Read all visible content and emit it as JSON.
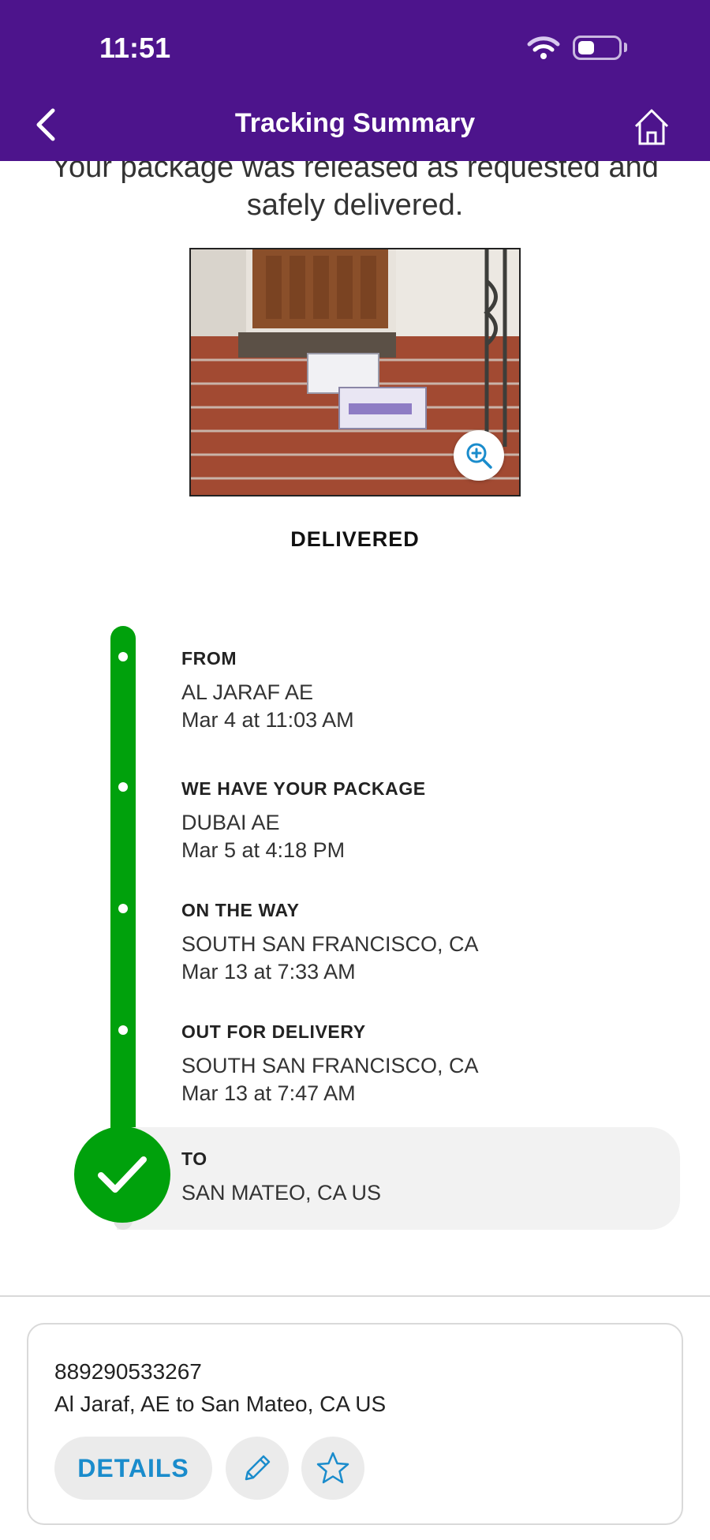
{
  "status_bar": {
    "time": "11:51"
  },
  "header": {
    "title": "Tracking Summary"
  },
  "message": "Your package was released as requested and safely delivered.",
  "status": "DELIVERED",
  "timeline": [
    {
      "label": "FROM",
      "lines": [
        "AL JARAF AE",
        "Mar 4 at 11:03 AM"
      ]
    },
    {
      "label": "WE HAVE YOUR PACKAGE",
      "lines": [
        "DUBAI AE",
        "Mar 5 at 4:18 PM"
      ]
    },
    {
      "label": "ON THE WAY",
      "lines": [
        "SOUTH SAN FRANCISCO, CA",
        "Mar 13 at 7:33 AM"
      ]
    },
    {
      "label": "OUT FOR DELIVERY",
      "lines": [
        "SOUTH SAN FRANCISCO, CA",
        "Mar 13 at 7:47 AM"
      ]
    },
    {
      "label": "TO",
      "lines": [
        "SAN MATEO, CA  US"
      ]
    }
  ],
  "card": {
    "tracking_number": "889290533267",
    "route": "Al Jaraf, AE to San Mateo, CA US",
    "details_label": "DETAILS"
  },
  "colors": {
    "brand_purple": "#4d148c",
    "delivered_green": "#00a10c",
    "link_blue": "#1a8ccc"
  },
  "icons": [
    "back-icon",
    "home-icon",
    "zoom-in-icon",
    "checkmark-icon",
    "edit-pencil-icon",
    "star-icon",
    "wifi-icon",
    "battery-icon"
  ]
}
